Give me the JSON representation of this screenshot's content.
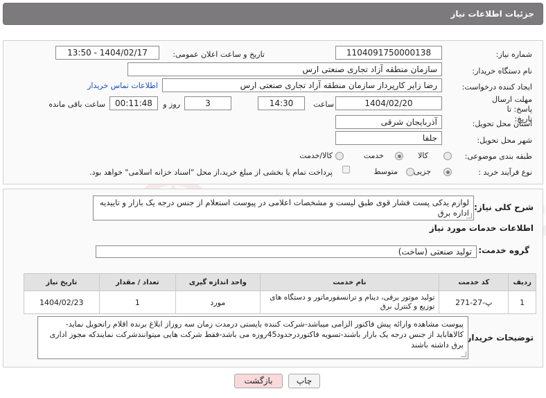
{
  "header": {
    "title": "جزئیات اطلاعات نیاز"
  },
  "fields": {
    "need_number_label": "شماره نیاز:",
    "need_number": "1104091750000138",
    "announce_label": "تاریخ و ساعت اعلان عمومی:",
    "announce_value": "1404/02/17 - 13:50",
    "buyer_org_label": "نام دستگاه خریدار:",
    "buyer_org": "سازمان منطقه آزاد تجاری صنعتی ارس",
    "creator_label": "ایجاد کننده درخواست:",
    "creator": "رضا زایر کارپرداز سازمان منطقه آزاد تجاری صنعتی ارس",
    "contact_link": "اطلاعات تماس خریدار",
    "deadline_label": "مهلت ارسال پاسخ: تا تاریخ:",
    "deadline_date": "1404/02/20",
    "time_label": "ساعت",
    "deadline_time": "14:30",
    "days": "3",
    "days_label": "روز و",
    "remaining": "00:11:48",
    "remaining_label": "ساعت باقی مانده",
    "province_label": "استان محل تحویل:",
    "province": "آذربایجان شرقی",
    "city_label": "شهر محل تحویل:",
    "city": "جلفا",
    "category_label": "طبقه بندی موضوعی:",
    "category_options": [
      "کالا",
      "خدمت",
      "کالا/خدمت"
    ],
    "category_selected": "خدمت",
    "process_label": "نوع فرآیند خرید :",
    "process_options": [
      "جزیی",
      "متوسط"
    ],
    "process_selected": "جزیی",
    "payment_note": "پرداخت تمام یا بخشی از مبلغ خرید،از محل \"اسناد خزانه اسلامی\" خواهد بود."
  },
  "description": {
    "label": "شرح کلی نیاز:",
    "text": "لوازم یدکی پست فشار قوی طبق لیست و مشخصات اعلامی در پیوست استعلام از جنس درجه یک بازار و تاییدیه اداره برق"
  },
  "services": {
    "section_title": "اطلاعات خدمات مورد نیاز",
    "group_label": "گروه خدمت:",
    "group_value": "تولید صنعتی (ساخت)",
    "columns": [
      "ردیف",
      "کد خدمت",
      "نام خدمت",
      "واحد اندازه گیری",
      "تعداد / مقدار",
      "تاریخ نیاز"
    ],
    "rows": [
      {
        "row": "1",
        "code": "پ-27-271",
        "name": "تولید موتور برقی، دینام و ترانسفورماتور و دستگاه های توزیع و کنترل برق",
        "unit": "مورد",
        "qty": "1",
        "date": "1404/02/23"
      }
    ]
  },
  "buyer_notes": {
    "label": "توضیحات خریدار:",
    "text": "پیوست مشاهده وارائه پیش فاکتور الزامی میباشد-شرکت کننده بایستی درمدت زمان سه روزاز ابلاغ برنده اقلام راتحویل نماید-کالاهاباید از جنس درجه یک بازار باشند-تسویه فاکتوردرحدود45روزه می باشد-فقط شرکت هایی میتوانندشرکت نمایندکه مجوز اداری برق داشته باشند"
  },
  "buttons": {
    "print": "چاپ",
    "back": "بازگشت"
  },
  "watermark": {
    "brand": "AriaTender.neT"
  },
  "colors": {
    "header_bg": "#7d7a7d",
    "link": "#1a4fbf",
    "back_button_bg": "#f9d9d9"
  }
}
